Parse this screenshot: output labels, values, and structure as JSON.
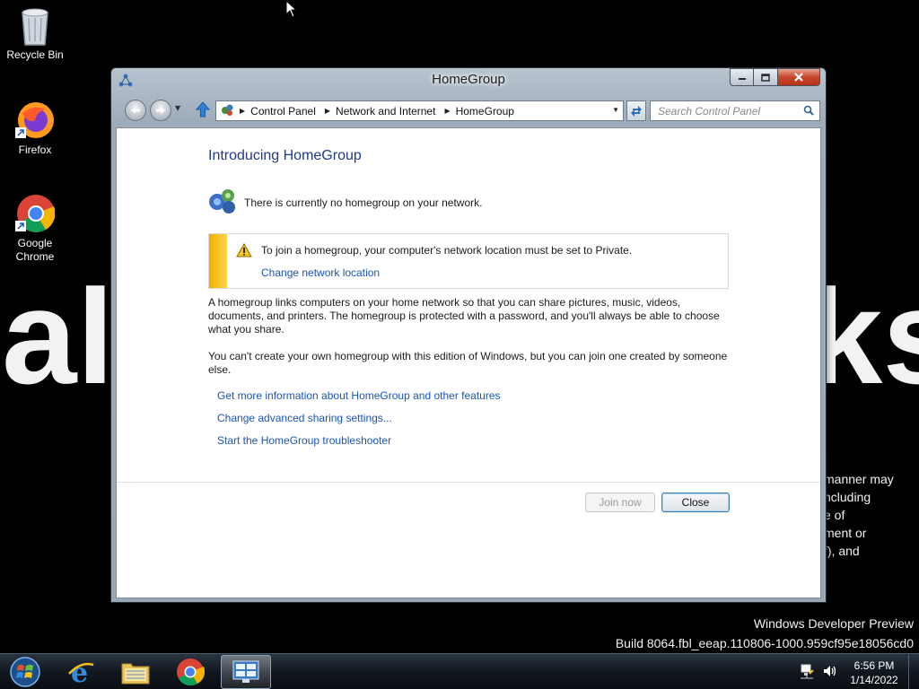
{
  "desktop": {
    "icons": [
      {
        "label": "Recycle Bin"
      },
      {
        "label": "Firefox"
      },
      {
        "label": "Google Chrome"
      }
    ],
    "wallpaper_left_text": "al",
    "wallpaper_right_text": "ks",
    "wallpaper_paragraph": [
      "manner may",
      "ncluding",
      "e of",
      "ment or",
      "f), and"
    ],
    "watermark_line1": "Windows Developer Preview",
    "watermark_line2": "Build 8064.fbl_eeap.110806-1000.959cf95e18056cd0"
  },
  "window": {
    "title": "HomeGroup",
    "breadcrumbs": [
      "Control Panel",
      "Network and Internet",
      "HomeGroup"
    ],
    "search_placeholder": "Search Control Panel"
  },
  "content": {
    "heading": "Introducing HomeGroup",
    "status": "There is currently no homegroup on your network.",
    "info_text": "To join a homegroup, your computer's network location must be set to Private.",
    "info_link": "Change network location",
    "paragraph1": "A homegroup links computers on your home network so that you can share pictures, music, videos, documents, and printers. The homegroup is protected with a password, and you'll always be able to choose what you share.",
    "paragraph2": "You can't create your own homegroup with this edition of Windows, but you can join one created by someone else.",
    "links": [
      "Get more information about HomeGroup and other features",
      "Change advanced sharing settings...",
      "Start the HomeGroup troubleshooter"
    ],
    "join_button": "Join now",
    "close_button": "Close"
  },
  "taskbar": {
    "time": "6:56 PM",
    "date": "1/14/2022"
  },
  "colors": {
    "link": "#1a55b5",
    "heading": "#1e3a8a",
    "warning_stripe": "#f0b000"
  }
}
